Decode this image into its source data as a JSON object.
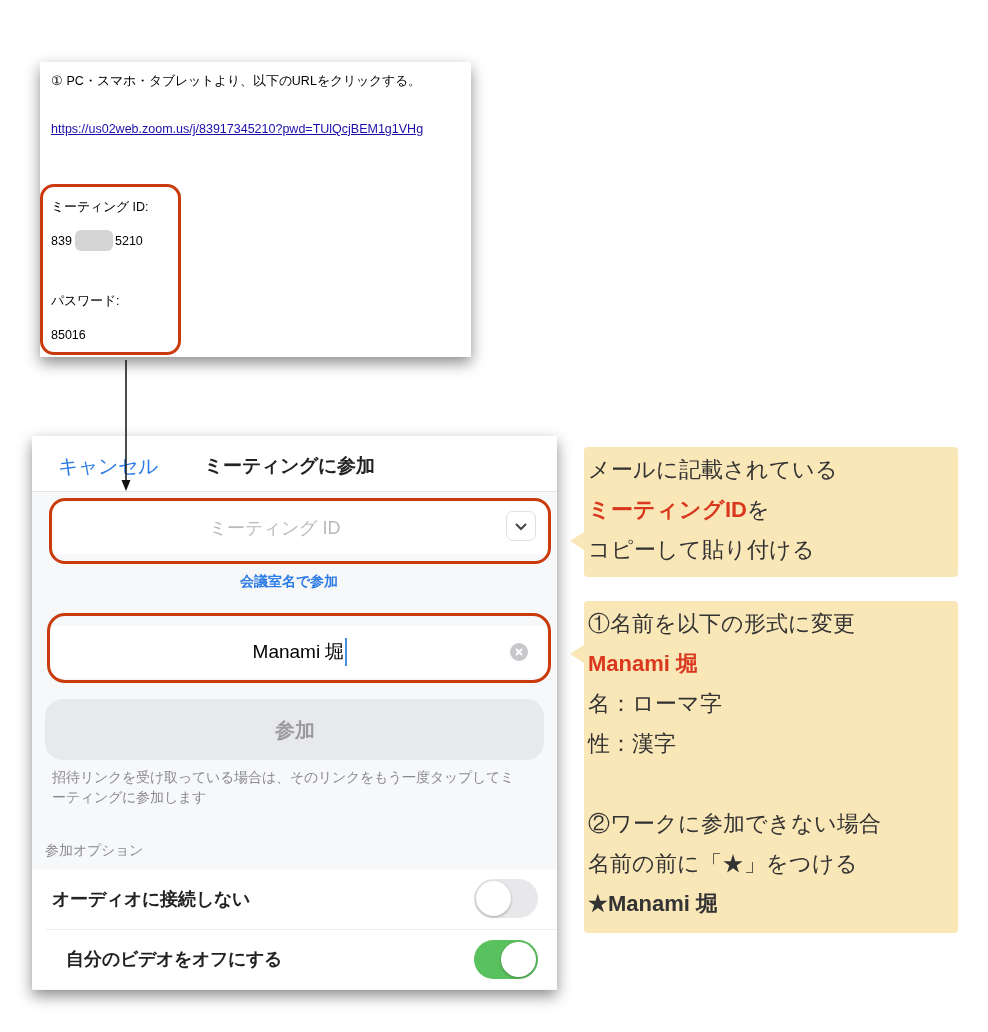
{
  "email": {
    "instruction": "① PC・スマホ・タブレットより、以下のURLをクリックする。",
    "link": "https://us02web.zoom.us/j/83917345210?pwd=TUlQcjBEM1g1VHg",
    "meeting_id_label": "ミーティング ID:",
    "meeting_id_start": "839",
    "meeting_id_end": "5210",
    "password_label": "パスワード:",
    "password": "85016"
  },
  "phone": {
    "cancel": "キャンセル",
    "title": "ミーティングに参加",
    "id_placeholder": "ミーティング ID",
    "join_by_room": "会議室名で参加",
    "name_value": "Manami 堀",
    "join_button": "参加",
    "hint": "招待リンクを受け取っている場合は、そのリンクをもう一度タップしてミーティングに参加します",
    "options_header": "参加オプション",
    "options": [
      {
        "label": "オーディオに接続しない",
        "on": false
      },
      {
        "label": "自分のビデオをオフにする",
        "on": true
      }
    ]
  },
  "callouts": [
    {
      "groups": [
        [
          [
            {
              "text": "メールに記載されている",
              "kind": "plain"
            }
          ],
          [
            {
              "text": "ミーティングID",
              "kind": "red"
            },
            {
              "text": "を",
              "kind": "plain"
            }
          ],
          [
            {
              "text": "コピーして貼り付ける",
              "kind": "plain"
            }
          ]
        ]
      ]
    },
    {
      "groups": [
        [
          [
            {
              "text": "①名前を以下の形式に変更",
              "kind": "plain"
            }
          ],
          [
            {
              "text": "Manami 堀",
              "kind": "red"
            }
          ],
          [
            {
              "text": "名：ローマ字",
              "kind": "plain"
            }
          ],
          [
            {
              "text": "性：漢字",
              "kind": "plain"
            }
          ]
        ],
        [
          [
            {
              "text": "②ワークに参加できない場合",
              "kind": "plain"
            }
          ],
          [
            {
              "text": "名前の前に「★」をつける",
              "kind": "plain"
            }
          ],
          [
            {
              "text": "★Manami 堀",
              "kind": "bold"
            }
          ]
        ]
      ]
    }
  ]
}
